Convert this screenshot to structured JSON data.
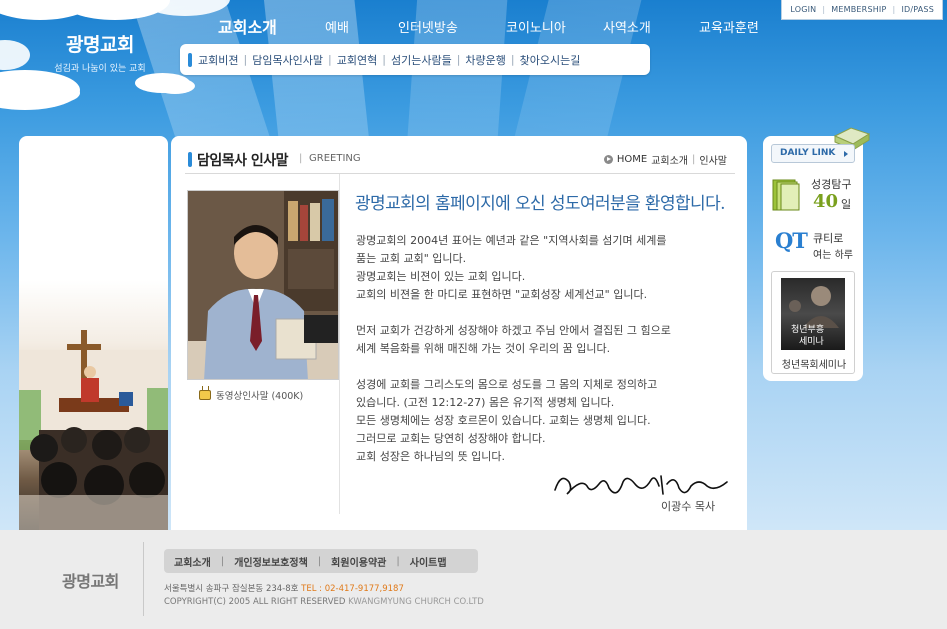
{
  "site": {
    "name": "광명교회",
    "tagline": "섬김과 나눔이 있는 교회"
  },
  "util": [
    "LOGIN",
    "MEMBERSHIP",
    "ID/PASS"
  ],
  "gnb": [
    "교회소개",
    "예배",
    "인터넷방송",
    "코이노니아",
    "사역소개",
    "교육과훈련"
  ],
  "lnb": [
    "교회비젼",
    "담임목사인사말",
    "교회연혁",
    "섬기는사람들",
    "차량운행",
    "찾아오시는길"
  ],
  "page": {
    "title": "담임목사 인사말",
    "subtitle": "GREETING",
    "breadcrumb": [
      "HOME",
      "교회소개",
      "인사말"
    ]
  },
  "video_link": "동영상인사말 (400K)",
  "greeting": {
    "headline": "광명교회의 홈페이지에 오신 성도여러분을 환영합니다.",
    "paragraphs": [
      [
        "광명교회의 2004년 표어는 예년과 같은 \"지역사회를 섬기며 세계를",
        "품는 교회 교회\" 입니다.",
        "광명교회는 비젼이 있는 교회 입니다.",
        "교회의 비젼을 한 마디로 표현하면 \"교회성장 세계선교\" 입니다."
      ],
      [
        "먼저 교회가 건강하게 성장해야 하겠고 주님 안에서 결집된 그 힘으로",
        "세계 복음화를 위해 매진해 가는 것이 우리의 꿈 입니다."
      ],
      [
        "성경에 교회를 그리스도의 몸으로 성도를 그 몸의 지체로 정의하고",
        "있습니다. (고전 12:12-27) 몸은 유기적 생명체 입니다.",
        "모든 생명체에는 성장 호르몬이 있습니다. 교회는 생명체 입니다.",
        "그러므로 교회는 당연히 성장해야 합니다.",
        "교회 성장은 하나님의 뜻 입니다."
      ]
    ],
    "signer": "이광수 목사"
  },
  "quick_links": {
    "header": "DAILY LINK",
    "bible": {
      "label": "성경탐구",
      "number": "40",
      "unit": "일"
    },
    "qt": {
      "badge": "QT",
      "line1": "큐티로",
      "line2": "여는 하루"
    },
    "seminar": {
      "img_line1": "청년부흥",
      "img_line2": "세미나",
      "caption": "청년목회세미나"
    }
  },
  "footer": {
    "logo": "광명교회",
    "nav": [
      "교회소개",
      "개인정보보호정책",
      "회원이용약관",
      "사이트맵"
    ],
    "address": "서울특별시 송파구 잠실본동 234-8호",
    "tel": "TEL : 02-417-9177,9187",
    "copyright": "COPYRIGHT(C) 2005 ALL RIGHT RESERVED",
    "company": "KWANGMYUNG CHURCH CO.LTD"
  },
  "colors": {
    "sky_top": "#1a7fcf",
    "accent_blue": "#2a8bd8",
    "headline": "#2d6aa8",
    "tel_orange": "#e07a1a",
    "bible_green": "#7aa01e"
  }
}
